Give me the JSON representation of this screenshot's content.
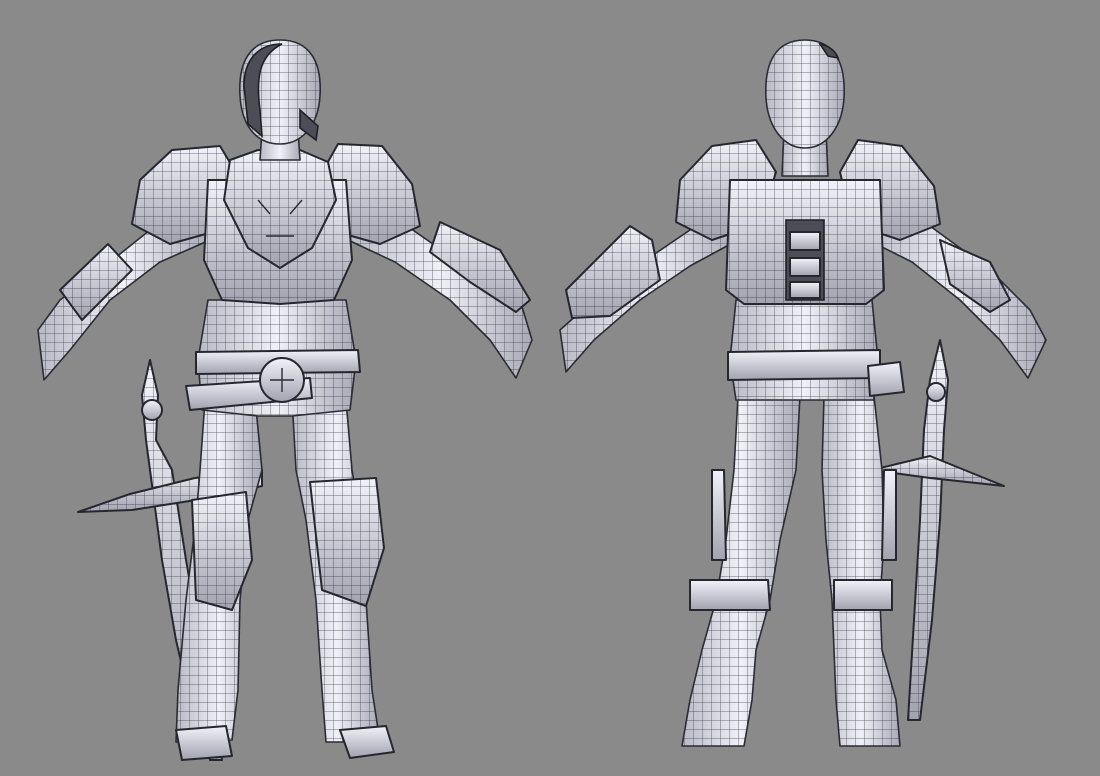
{
  "scene": {
    "background_color": "#8a8a8a",
    "model_color": "#e4e4ee",
    "wire_color": "#2a2a32",
    "views": [
      {
        "name": "front",
        "description_icon": "armored-knight-front-wireframe"
      },
      {
        "name": "back",
        "description_icon": "armored-knight-back-wireframe"
      }
    ]
  }
}
